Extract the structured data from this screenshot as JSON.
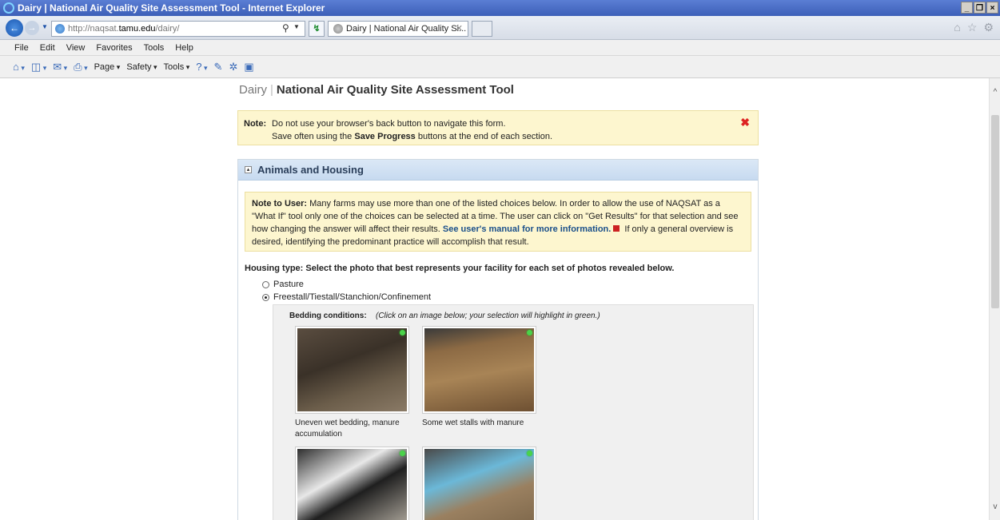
{
  "window": {
    "title": "Dairy | National Air Quality Site Assessment Tool - Internet Explorer"
  },
  "address_bar": {
    "url_prefix": "http://naqsat.",
    "url_domain": "tamu.edu",
    "url_path": "/dairy/"
  },
  "tab": {
    "label": "Dairy | National Air Quality Si..."
  },
  "menu": [
    "File",
    "Edit",
    "View",
    "Favorites",
    "Tools",
    "Help"
  ],
  "command_bar": {
    "page": "Page",
    "safety": "Safety",
    "tools": "Tools"
  },
  "page": {
    "brand": "Dairy",
    "title": "National Air Quality Site Assessment Tool"
  },
  "note": {
    "label": "Note:",
    "line1": "Do not use your browser's back button to navigate this form.",
    "line2_prefix": "Save often using the ",
    "line2_bold": "Save Progress",
    "line2_suffix": " buttons at the end of each section."
  },
  "section": {
    "title": "Animals and Housing",
    "user_note": {
      "label": "Note to User:",
      "text": " Many farms may use more than one of the listed choices below. In order to allow the use of NAQSAT as a \"What If\" tool only one of the choices can be selected at a time. The user can click on \"Get Results\" for that selection and see how changing the answer will affect their results. ",
      "link": "See user's manual for more information.",
      "text2": " If only a general overview is desired, identifying the predominant practice will accomplish that result."
    },
    "question": "Housing type: Select the photo that best represents your facility for each set of photos revealed below.",
    "options": [
      {
        "label": "Pasture",
        "selected": false
      },
      {
        "label": "Freestall/Tiestall/Stanchion/Confinement",
        "selected": true
      }
    ],
    "bedding": {
      "label": "Bedding conditions:",
      "hint": "(Click on an image below; your selection will highlight in green.)",
      "photos": [
        {
          "caption": "Uneven wet bedding, manure accumulation",
          "icon": "bedding-photo-1"
        },
        {
          "caption": "Some wet stalls with manure",
          "icon": "bedding-photo-2"
        },
        {
          "caption": "",
          "icon": "bedding-photo-3"
        },
        {
          "caption": "",
          "icon": "bedding-photo-4"
        }
      ]
    }
  }
}
